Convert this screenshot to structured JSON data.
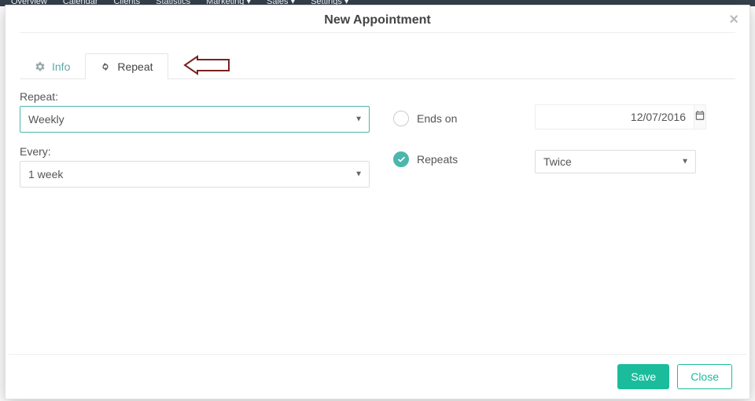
{
  "bgnav": {
    "items": [
      "Overview",
      "Calendar",
      "Clients",
      "Statistics",
      "Marketing ▾",
      "Sales ▾",
      "Settings ▾"
    ]
  },
  "modal": {
    "title": "New Appointment",
    "close_glyph": "×",
    "tabs": {
      "info": "Info",
      "repeat": "Repeat"
    },
    "form": {
      "repeat_label": "Repeat:",
      "repeat_value": "Weekly",
      "every_label": "Every:",
      "every_value": "1 week",
      "ends_on_label": "Ends on",
      "ends_on_date": "12/07/2016",
      "repeats_label": "Repeats",
      "repeats_value": "Twice"
    },
    "footer": {
      "save": "Save",
      "close": "Close"
    }
  }
}
